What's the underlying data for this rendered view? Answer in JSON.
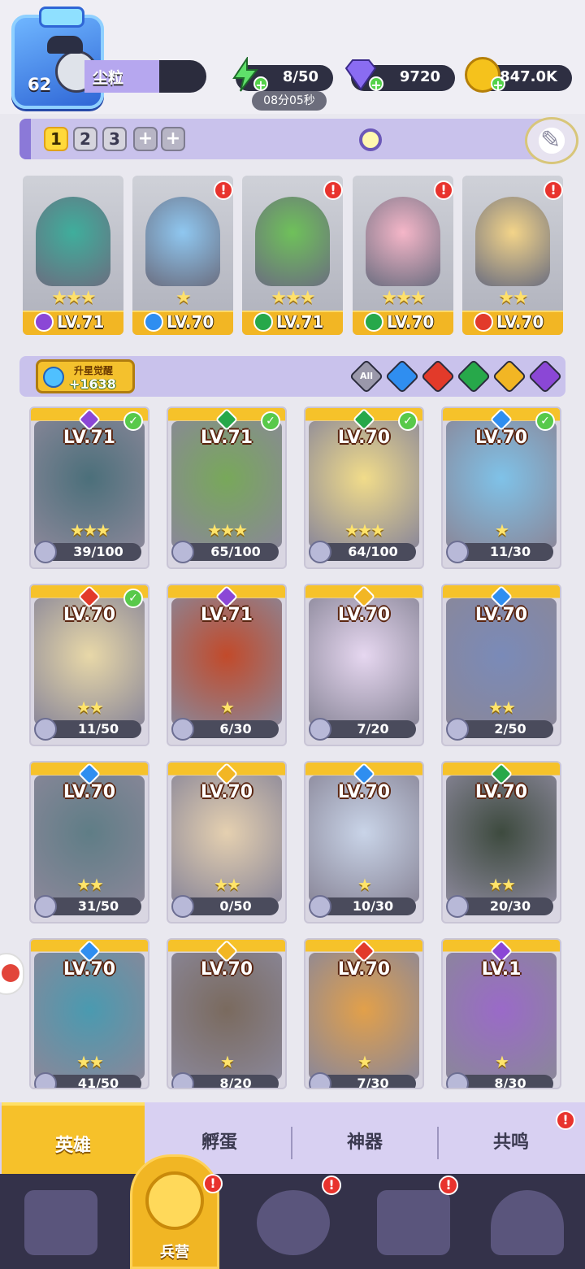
{
  "player": {
    "level": "62",
    "name": "尘粒"
  },
  "resources": {
    "energy": "8/50",
    "energy_timer": "08分05秒",
    "gems": "9720",
    "gold": "847.0K"
  },
  "teams": {
    "slots": [
      "1",
      "2",
      "3",
      "+",
      "+"
    ],
    "active": 0
  },
  "team_cards": [
    {
      "level": "LV.71",
      "element": "shadow",
      "element_color": "#8b47d6",
      "stars": "★★★",
      "hero_color": "#3fae9c",
      "alert": false
    },
    {
      "level": "LV.70",
      "element": "water",
      "element_color": "#2f8ef0",
      "stars": "★",
      "hero_color": "#8fc7f0",
      "alert": true
    },
    {
      "level": "LV.71",
      "element": "nature",
      "element_color": "#27a84a",
      "stars": "★★★",
      "hero_color": "#6fc15a",
      "alert": true
    },
    {
      "level": "LV.70",
      "element": "nature",
      "element_color": "#27a84a",
      "stars": "★★★",
      "hero_color": "#f5b6c8",
      "alert": true
    },
    {
      "level": "LV.70",
      "element": "fire",
      "element_color": "#e23a2a",
      "stars": "★★",
      "hero_color": "#f3d489",
      "alert": true
    }
  ],
  "awaken": {
    "label": "升星觉醒",
    "count": "+1638"
  },
  "filters": [
    {
      "name": "All",
      "color": "#9a98aa"
    },
    {
      "name": "water",
      "color": "#2f8ef0"
    },
    {
      "name": "fire",
      "color": "#e23a2a"
    },
    {
      "name": "nature",
      "color": "#27a84a"
    },
    {
      "name": "light",
      "color": "#f2b624"
    },
    {
      "name": "shadow",
      "color": "#8b47d6"
    }
  ],
  "heroes": [
    {
      "level": "LV.71",
      "element_color": "#8b47d6",
      "stars": "★★★",
      "progress": "39/100",
      "check": true,
      "art": "#4b6f7a"
    },
    {
      "level": "LV.71",
      "element_color": "#27a84a",
      "stars": "★★★",
      "progress": "65/100",
      "check": true,
      "art": "#78a85a"
    },
    {
      "level": "LV.70",
      "element_color": "#27a84a",
      "stars": "★★★",
      "progress": "64/100",
      "check": true,
      "art": "#f1dc8a"
    },
    {
      "level": "LV.70",
      "element_color": "#2f8ef0",
      "stars": "★",
      "progress": "11/30",
      "check": true,
      "art": "#7fc2e8"
    },
    {
      "level": "LV.70",
      "element_color": "#e23a2a",
      "stars": "★★",
      "progress": "11/50",
      "check": true,
      "art": "#e8d8a8"
    },
    {
      "level": "LV.71",
      "element_color": "#8b47d6",
      "stars": "★",
      "progress": "6/30",
      "check": false,
      "art": "#c24a2a"
    },
    {
      "level": "LV.70",
      "element_color": "#f2b624",
      "stars": "",
      "progress": "7/20",
      "check": false,
      "art": "#e6d7f0"
    },
    {
      "level": "LV.70",
      "element_color": "#2f8ef0",
      "stars": "★★",
      "progress": "2/50",
      "check": false,
      "art": "#7a8ab8"
    },
    {
      "level": "LV.70",
      "element_color": "#2f8ef0",
      "stars": "★★",
      "progress": "31/50",
      "check": false,
      "art": "#5f7d86"
    },
    {
      "level": "LV.70",
      "element_color": "#f2b624",
      "stars": "★★",
      "progress": "0/50",
      "check": false,
      "art": "#e5d0b0"
    },
    {
      "level": "LV.70",
      "element_color": "#2f8ef0",
      "stars": "★",
      "progress": "10/30",
      "check": false,
      "art": "#c9d4e8"
    },
    {
      "level": "LV.70",
      "element_color": "#27a84a",
      "stars": "★★",
      "progress": "20/30",
      "check": false,
      "art": "#3d4a3e"
    },
    {
      "level": "LV.70",
      "element_color": "#2f8ef0",
      "stars": "★★",
      "progress": "41/50",
      "check": false,
      "art": "#4a9ab0"
    },
    {
      "level": "LV.70",
      "element_color": "#f2b624",
      "stars": "★",
      "progress": "8/20",
      "check": false,
      "art": "#7a6a5e"
    },
    {
      "level": "LV.70",
      "element_color": "#e23a2a",
      "stars": "★",
      "progress": "7/30",
      "check": false,
      "art": "#e2a04a"
    },
    {
      "level": "LV.1",
      "element_color": "#8b47d6",
      "stars": "★",
      "progress": "8/30",
      "check": false,
      "art": "#9a6ac8"
    }
  ],
  "tabs": {
    "heroes": "英雄",
    "hatch": "孵蛋",
    "artifacts": "神器",
    "resonance": "共鸣"
  },
  "nav": {
    "barracks": "兵营"
  }
}
